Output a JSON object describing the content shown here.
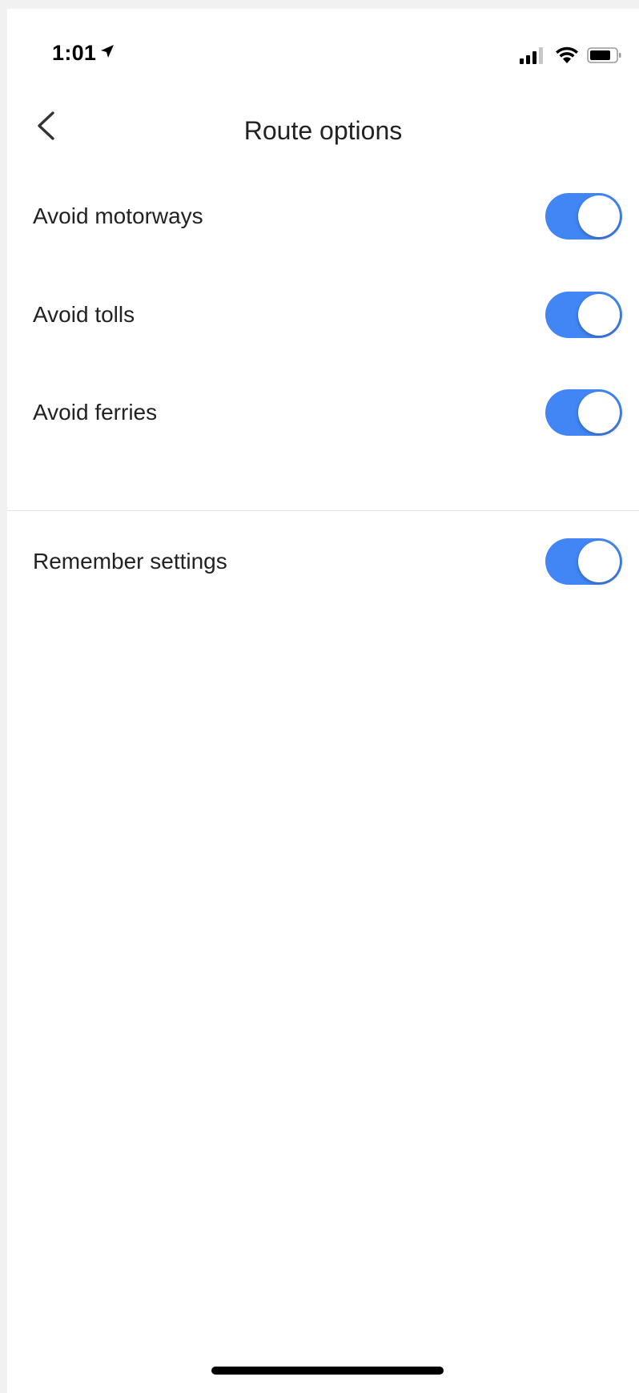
{
  "status_bar": {
    "time": "1:01",
    "icons": [
      "location-arrow-icon",
      "signal-bars-icon",
      "wifi-icon",
      "battery-icon"
    ]
  },
  "header": {
    "title": "Route options",
    "back_icon": "chevron-left-icon"
  },
  "options": [
    {
      "label": "Avoid motorways",
      "enabled": true
    },
    {
      "label": "Avoid tolls",
      "enabled": true
    },
    {
      "label": "Avoid ferries",
      "enabled": true
    }
  ],
  "remember": {
    "label": "Remember settings",
    "enabled": true
  },
  "colors": {
    "toggle_on": "#4285f4",
    "background": "#ffffff",
    "text": "#222222",
    "divider": "#e3e3e3"
  }
}
